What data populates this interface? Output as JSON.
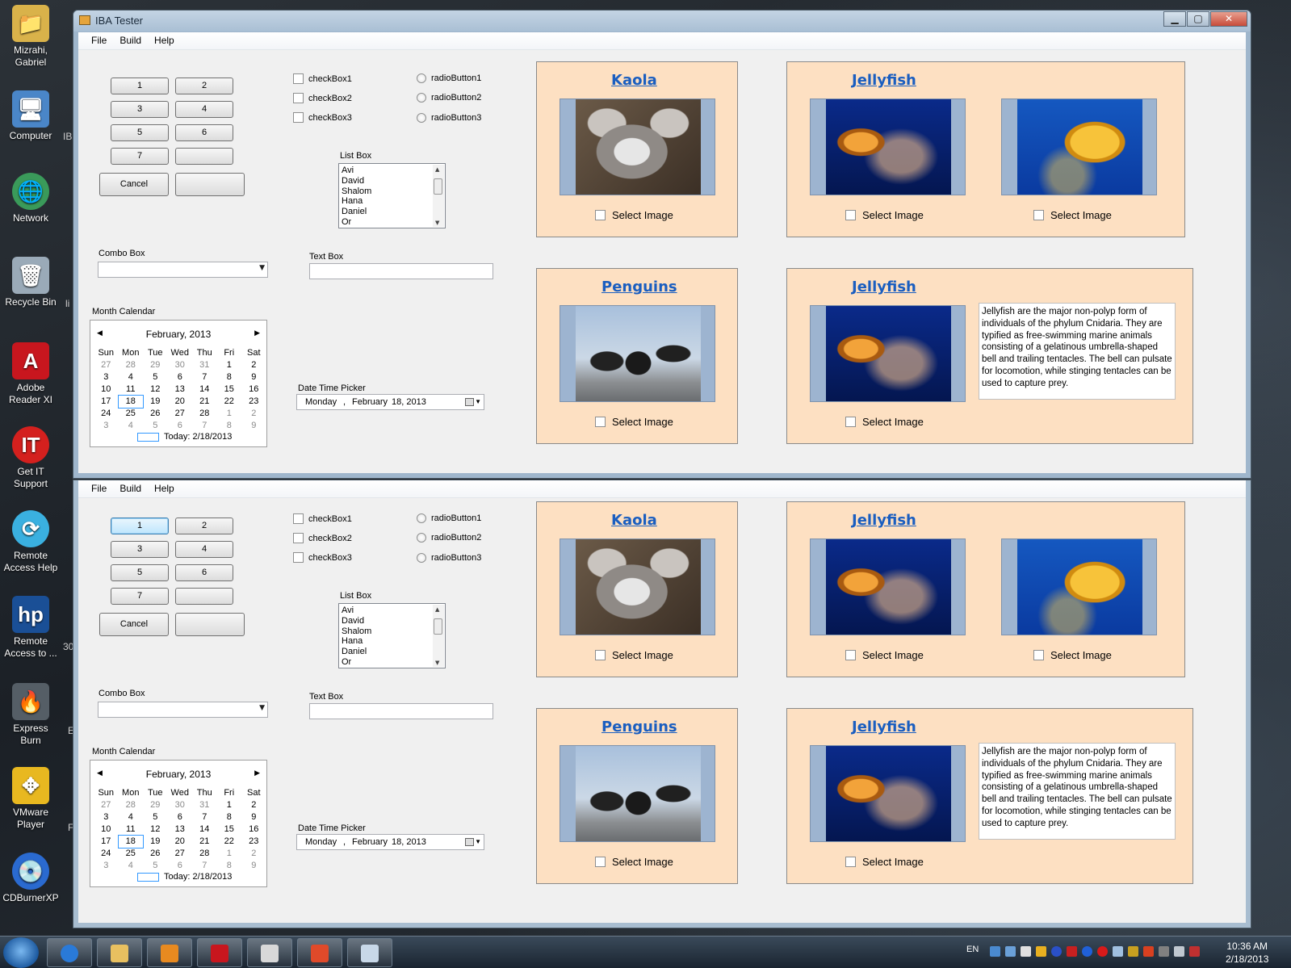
{
  "desktop": {
    "icons": [
      {
        "label": "Mizrahi, Gabriel",
        "icon": "user-folder-icon"
      },
      {
        "label": "Computer",
        "icon": "computer-icon"
      },
      {
        "label": "Network",
        "icon": "network-icon"
      },
      {
        "label": "Recycle Bin",
        "icon": "recycle-bin-icon"
      },
      {
        "label": "Adobe Reader XI",
        "icon": "adobe-reader-icon"
      },
      {
        "label": "Get IT Support",
        "icon": "it-support-icon"
      },
      {
        "label": "Remote Access Help",
        "icon": "remote-access-help-icon"
      },
      {
        "label": "Remote Access to ...",
        "icon": "hp-remote-access-icon"
      },
      {
        "label": "Express Burn",
        "icon": "express-burn-icon"
      },
      {
        "label": "VMware Player",
        "icon": "vmware-icon"
      },
      {
        "label": "CDBurnerXP",
        "icon": "cdburner-icon"
      }
    ],
    "edge_labels": [
      "IB",
      "li",
      "30",
      "E",
      "F"
    ]
  },
  "window": {
    "title": "IBA Tester",
    "min": "▁",
    "max": "▢",
    "close": "✕"
  },
  "menu": [
    "File",
    "Build",
    "Help"
  ],
  "form": {
    "buttons": [
      "1",
      "2",
      "3",
      "4",
      "5",
      "6",
      "7",
      "",
      "Cancel",
      ""
    ],
    "checkboxes": [
      "checkBox1",
      "checkBox2",
      "checkBox3"
    ],
    "radios": [
      "radioButton1",
      "radioButton2",
      "radioButton3"
    ],
    "listbox_label": "List Box",
    "listbox_items": [
      "Avi",
      "David",
      "Shalom",
      "Hana",
      "Daniel",
      "Or"
    ],
    "combo_label": "Combo Box",
    "textbox_label": "Text Box",
    "calendar_label": "Month Calendar",
    "dtp_label": "Date Time Picker",
    "dtp_day": "Monday",
    "dtp_sep": ",",
    "dtp_month": "February",
    "dtp_date": "18, 2013"
  },
  "calendar": {
    "month": "February, 2013",
    "prev": "◀",
    "next": "▶",
    "weekdays": [
      "Sun",
      "Mon",
      "Tue",
      "Wed",
      "Thu",
      "Fri",
      "Sat"
    ],
    "weeks": [
      [
        "27",
        "28",
        "29",
        "30",
        "31",
        "1",
        "2"
      ],
      [
        "3",
        "4",
        "5",
        "6",
        "7",
        "8",
        "9"
      ],
      [
        "10",
        "11",
        "12",
        "13",
        "14",
        "15",
        "16"
      ],
      [
        "17",
        "18",
        "19",
        "20",
        "21",
        "22",
        "23"
      ],
      [
        "24",
        "25",
        "26",
        "27",
        "28",
        "1",
        "2"
      ],
      [
        "3",
        "4",
        "5",
        "6",
        "7",
        "8",
        "9"
      ]
    ],
    "selected": "18",
    "today": "Today: 2/18/2013"
  },
  "panels": {
    "koala_title": "Kaola",
    "jelly_title": "Jellyfish",
    "penguins_title": "Penguins",
    "jelly2_title": "Jellyfish",
    "select_image": "Select Image",
    "description": "Jellyfish are the major non-polyp form of individuals of the phylum Cnidaria. They are typified as free-swimming marine animals consisting of a gelatinous umbrella-shaped bell and trailing tentacles. The bell can pulsate for locomotion, while stinging tentacles can be used to capture prey."
  },
  "taskbar": {
    "language": "EN",
    "time": "10:36 AM",
    "date": "2/18/2013",
    "apps": [
      "internet-explorer-icon",
      "file-explorer-icon",
      "media-player-icon",
      "adobe-reader-icon",
      "paint-icon",
      "windows-app-icon",
      "form-app-icon"
    ]
  }
}
